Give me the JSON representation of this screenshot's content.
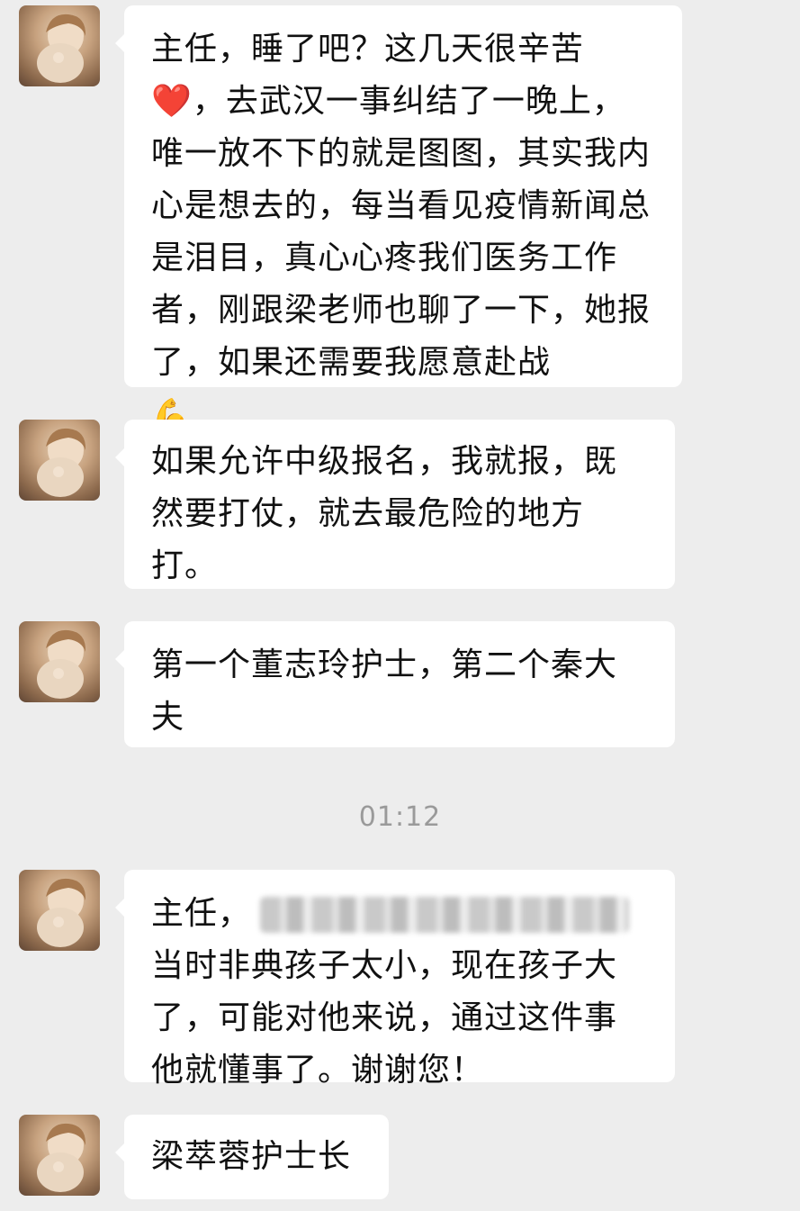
{
  "messages": [
    {
      "id": "m1",
      "segments": [
        {
          "type": "text",
          "text": "主任，睡了吧？这几天很辛苦"
        },
        {
          "type": "emoji",
          "name": "heart-emoji",
          "glyph": "❤️"
        },
        {
          "type": "text",
          "text": "，去武汉一事纠结了一晚上，唯一放不下的就是图图，其实我内心是想去的，每当看见疫情新闻总是泪目，真心心疼我们医务工作者，刚跟梁老师也聊了一下，她报了，如果还需要我愿意赴战"
        },
        {
          "type": "emoji",
          "name": "flexed-biceps-emoji",
          "glyph": "💪"
        }
      ]
    },
    {
      "id": "m2",
      "text": "如果允许中级报名，我就报，既然要打仗，就去最危险的地方打。"
    },
    {
      "id": "m3",
      "text": "第一个董志玲护士，第二个秦大夫"
    },
    {
      "id": "m4",
      "prefix": "主任，",
      "suffix": "当时非典孩子太小，现在孩子大了，可能对他来说，通过这件事他就懂事了。谢谢您！"
    },
    {
      "id": "m5",
      "text": "梁萃蓉护士长"
    }
  ],
  "timestamp": "01:12",
  "colors": {
    "background": "#ededed",
    "bubble": "#ffffff",
    "text": "#111111",
    "timestamp": "#9a9a9a"
  }
}
